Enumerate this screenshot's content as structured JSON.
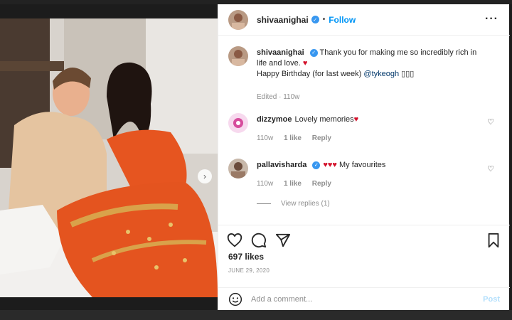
{
  "post": {
    "username": "shivaanighai",
    "dot": "•",
    "follow_label": "Follow",
    "more_label": "···"
  },
  "caption": {
    "username": "shivaanighai",
    "text1": "Thank you for making me so incredibly rich in life and love.",
    "heart": "♥",
    "text2": "Happy Birthday (for last week)",
    "mention": "@tykeogh",
    "trailing": "▯▯▯",
    "meta": "Edited · 110w"
  },
  "comments": [
    {
      "username": "dizzymoe",
      "text": "Lovely memories",
      "heart": "♥",
      "age": "110w",
      "likes": "1 like",
      "reply": "Reply"
    },
    {
      "username": "pallavisharda",
      "hearts": "♥♥♥",
      "text": "My favourites",
      "age": "110w",
      "likes": "1 like",
      "reply": "Reply"
    }
  ],
  "view_replies": "View replies (1)",
  "likes": "697 likes",
  "date": "JUNE 29, 2020",
  "add_comment": {
    "placeholder": "Add a comment...",
    "post_label": "Post"
  },
  "icons": {
    "heart": "heart-icon",
    "comment": "comment-icon",
    "share": "share-icon",
    "save": "bookmark-icon",
    "emoji": "emoji-icon"
  },
  "colors": {
    "accent": "#0095f6",
    "verified": "#3897f0",
    "heart_red": "#d3112b"
  }
}
